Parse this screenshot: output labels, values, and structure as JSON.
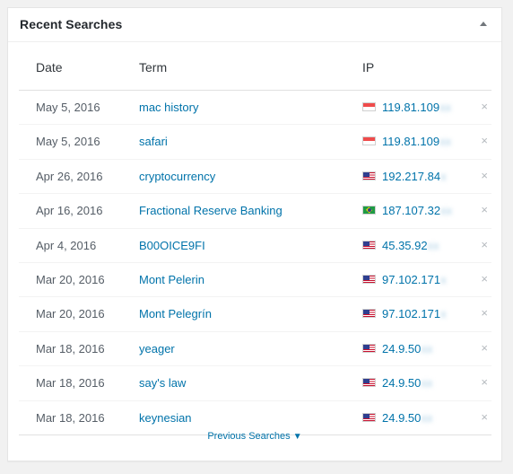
{
  "widget": {
    "title": "Recent Searches"
  },
  "table": {
    "headers": {
      "date": "Date",
      "term": "Term",
      "ip": "IP"
    },
    "rows": [
      {
        "date": "May 5, 2016",
        "term": "mac history",
        "flag": "singapore-flag-icon",
        "ip": "119.81.109",
        "ip_hidden": "xx"
      },
      {
        "date": "May 5, 2016",
        "term": "safari",
        "flag": "singapore-flag-icon",
        "ip": "119.81.109",
        "ip_hidden": "xx"
      },
      {
        "date": "Apr 26, 2016",
        "term": "cryptocurrency",
        "flag": "us-flag-icon",
        "ip": "192.217.84",
        "ip_hidden": "x"
      },
      {
        "date": "Apr 16, 2016",
        "term": "Fractional Reserve Banking",
        "flag": "brazil-flag-icon",
        "ip": "187.107.32",
        "ip_hidden": "xx"
      },
      {
        "date": "Apr 4, 2016",
        "term": "B00OICE9FI",
        "flag": "us-flag-icon",
        "ip": "45.35.92",
        "ip_hidden": "xx"
      },
      {
        "date": "Mar 20, 2016",
        "term": "Mont Pelerin",
        "flag": "us-flag-icon",
        "ip": "97.102.171",
        "ip_hidden": "x"
      },
      {
        "date": "Mar 20, 2016",
        "term": "Mont Pelegrín",
        "flag": "us-flag-icon",
        "ip": "97.102.171",
        "ip_hidden": "x"
      },
      {
        "date": "Mar 18, 2016",
        "term": "yeager",
        "flag": "us-flag-icon",
        "ip": "24.9.50",
        "ip_hidden": "xx"
      },
      {
        "date": "Mar 18, 2016",
        "term": "say's law",
        "flag": "us-flag-icon",
        "ip": "24.9.50",
        "ip_hidden": "xx"
      },
      {
        "date": "Mar 18, 2016",
        "term": "keynesian",
        "flag": "us-flag-icon",
        "ip": "24.9.50",
        "ip_hidden": "xx"
      }
    ],
    "remove_glyph": "×"
  },
  "footer": {
    "previous_label": "Previous Searches",
    "previous_glyph": "▼"
  },
  "colors": {
    "link": "#0073aa",
    "text": "#555d66",
    "heading": "#23282d"
  }
}
